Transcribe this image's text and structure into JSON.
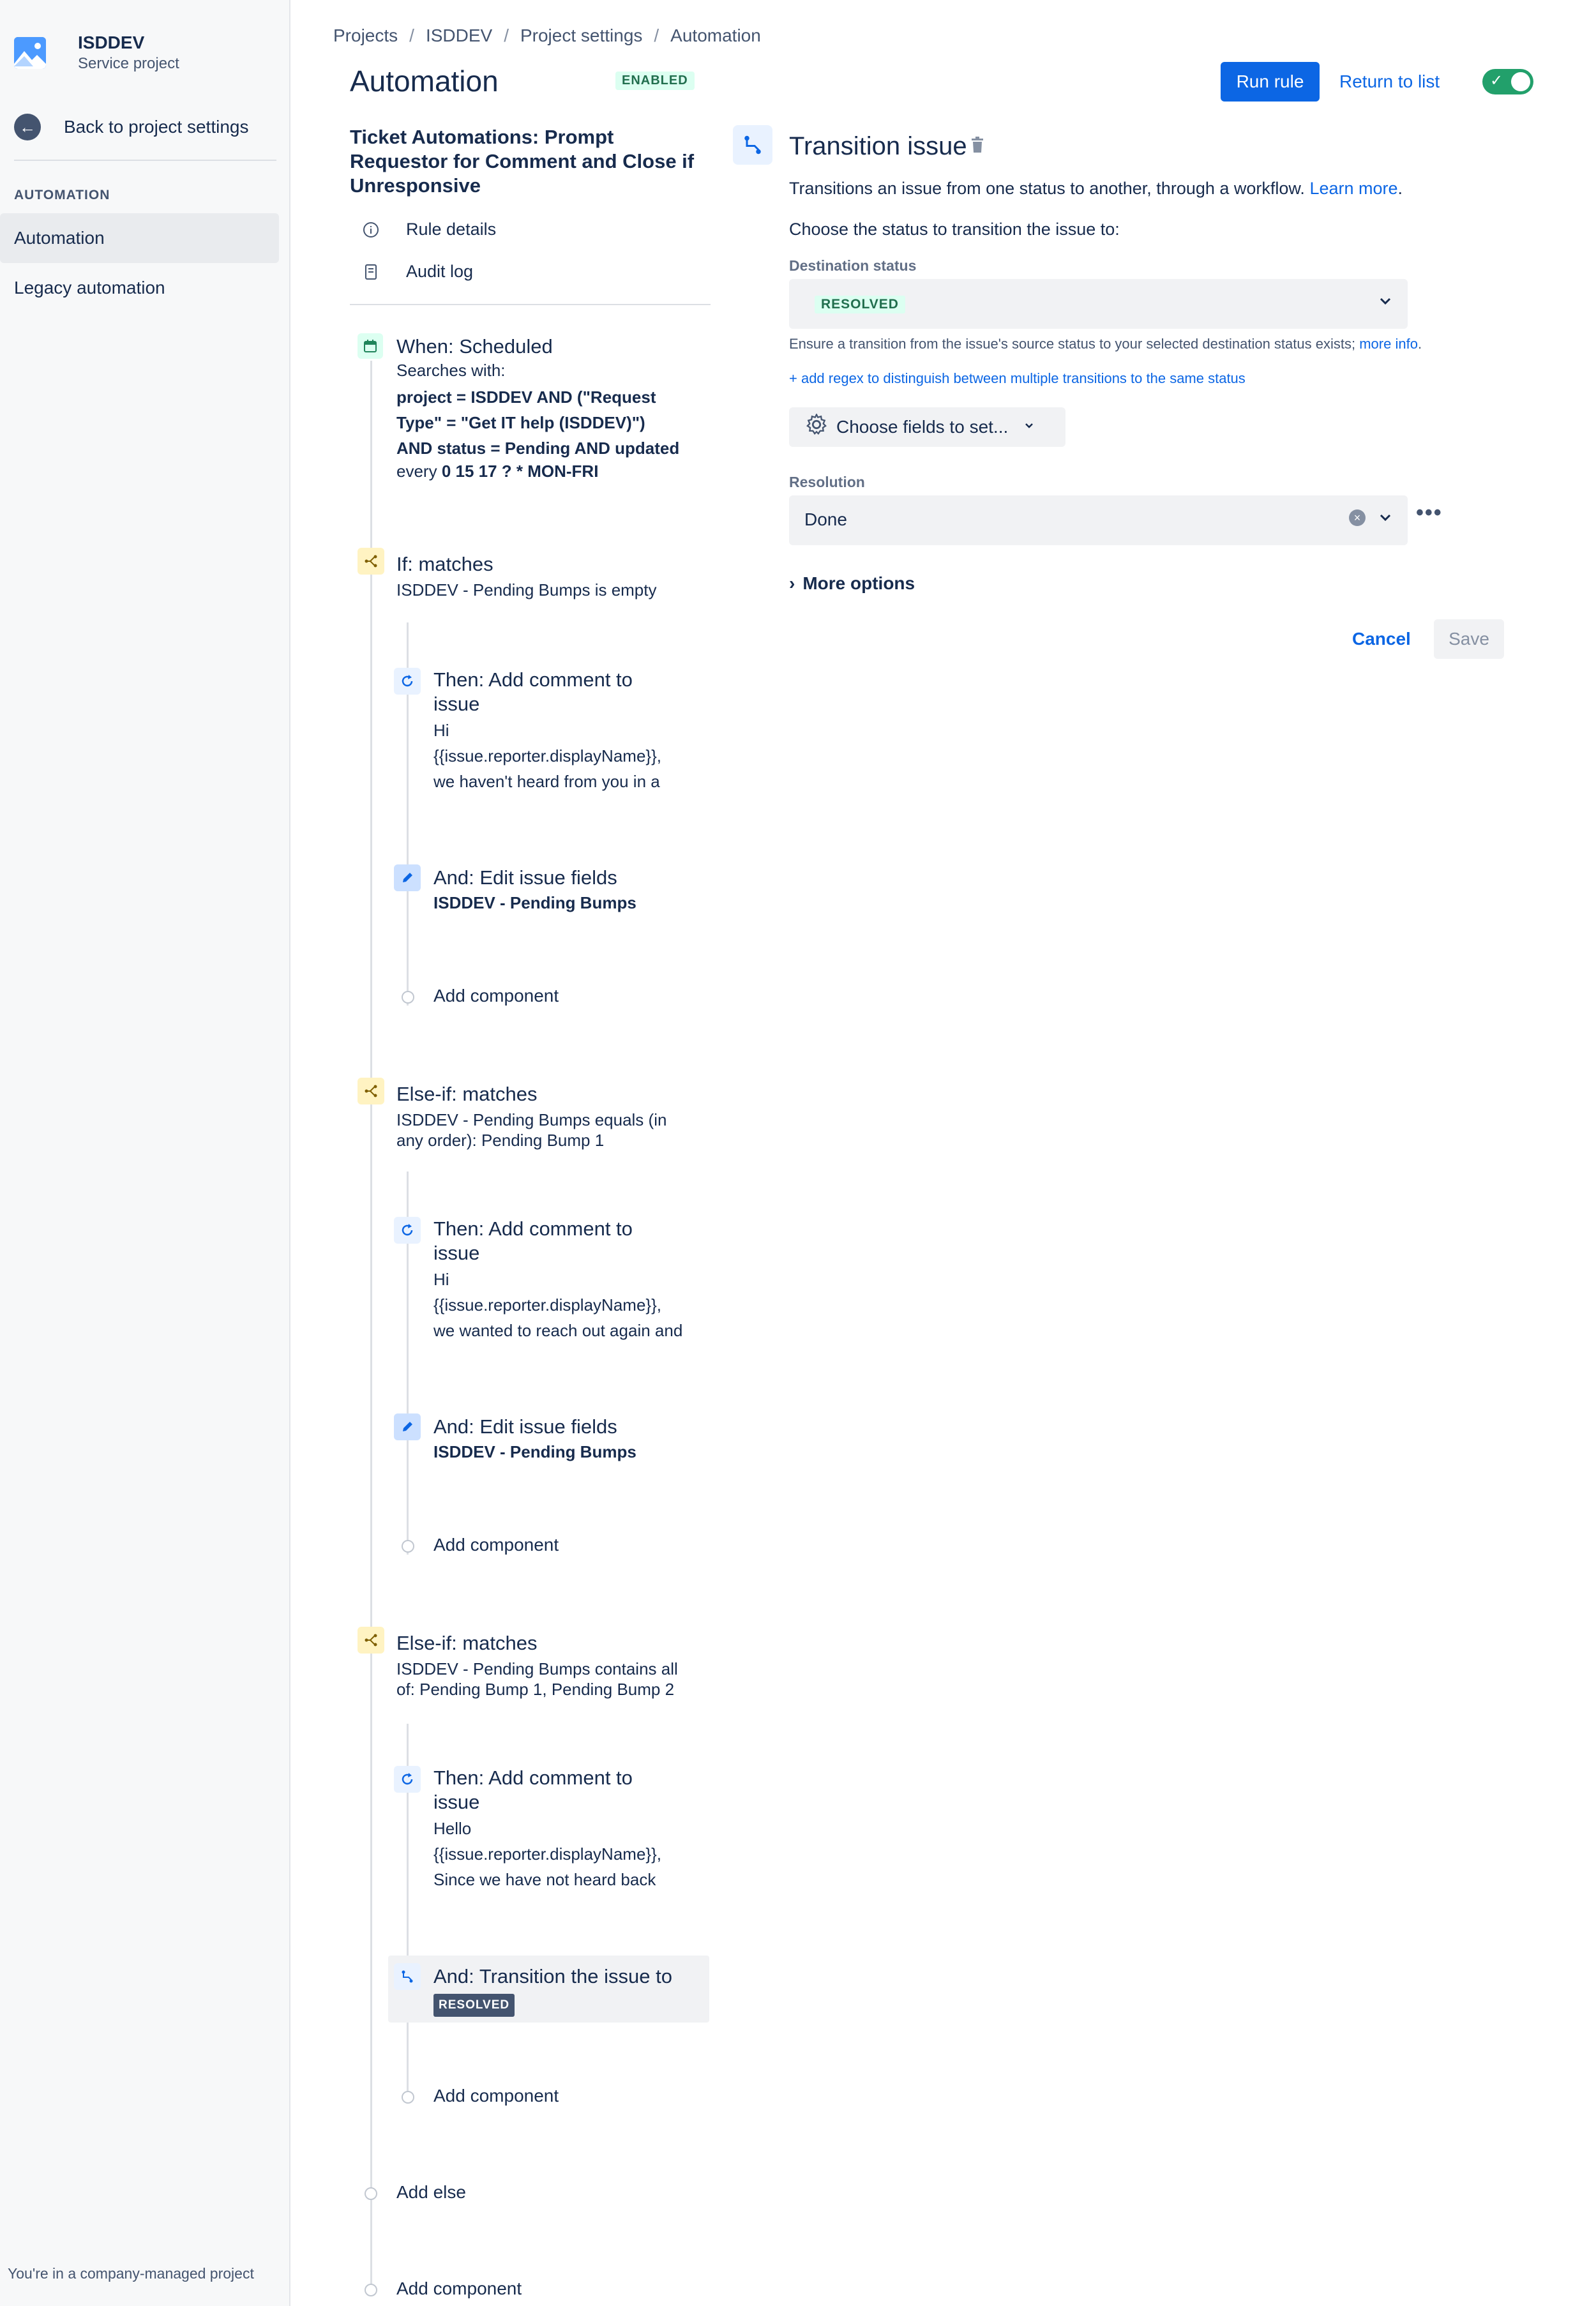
{
  "sidebar": {
    "project_name": "ISDDEV",
    "project_type": "Service project",
    "back_label": "Back to project settings",
    "section_label": "AUTOMATION",
    "items": [
      {
        "label": "Automation"
      },
      {
        "label": "Legacy automation"
      }
    ],
    "footer": "You're in a company-managed project"
  },
  "breadcrumb": [
    "Projects",
    "ISDDEV",
    "Project settings",
    "Automation"
  ],
  "header": {
    "title": "Automation",
    "status_badge": "ENABLED",
    "run_rule": "Run rule",
    "return_to_list": "Return to list"
  },
  "rule": {
    "title": "Ticket Automations: Prompt Requestor for Comment and Close if Unresponsive",
    "rule_details": "Rule details",
    "audit_log": "Audit log",
    "trigger": {
      "title": "When: Scheduled",
      "searches_with": "Searches with:",
      "jql_line1": "project = ISDDEV AND (\"Request",
      "jql_line2": "Type\" = \"Get IT help (ISDDEV)\")",
      "jql_line3": "AND status = Pending AND updated",
      "every": "every",
      "cron": "0 15 17 ? * MON-FRI"
    },
    "if1": {
      "title": "If: matches",
      "condition": "ISDDEV - Pending Bumps is empty"
    },
    "then1": {
      "title_line1": "Then: Add comment to",
      "title_line2": "issue",
      "text_line1": "Hi",
      "text_line2": "{{issue.reporter.displayName}},",
      "text_line3": "we haven't heard from you in a"
    },
    "and1": {
      "title": "And: Edit issue fields",
      "field": "ISDDEV - Pending Bumps"
    },
    "add_component": "Add component",
    "elseif1": {
      "title": "Else-if: matches",
      "cond_line1": "ISDDEV - Pending Bumps equals (in",
      "cond_line2": "any order): Pending Bump 1"
    },
    "then2": {
      "title_line1": "Then: Add comment to",
      "title_line2": "issue",
      "text_line1": "Hi",
      "text_line2": "{{issue.reporter.displayName}},",
      "text_line3": "we wanted to reach out again and"
    },
    "and2": {
      "title": "And: Edit issue fields",
      "field": "ISDDEV - Pending Bumps"
    },
    "elseif2": {
      "title": "Else-if: matches",
      "cond_line1": "ISDDEV - Pending Bumps contains all",
      "cond_line2": "of: Pending Bump 1, Pending Bump 2"
    },
    "then3": {
      "title_line1": "Then: Add comment to",
      "title_line2": "issue",
      "text_line1": "Hello",
      "text_line2": "{{issue.reporter.displayName}},",
      "text_line3": "Since we have not heard back"
    },
    "and3": {
      "title": "And: Transition the issue to",
      "status": "RESOLVED"
    },
    "add_else": "Add else"
  },
  "config": {
    "title": "Transition issue",
    "description": "Transitions an issue from one status to another, through a workflow.",
    "learn_more": "Learn more",
    "choose_prompt": "Choose the status to transition the issue to:",
    "destination_label": "Destination status",
    "destination_value": "RESOLVED",
    "ensure_text": "Ensure a transition from the issue's source status to your selected destination status exists;",
    "more_info": "more info",
    "add_regex": "+ add regex to distinguish between multiple transitions to the same status",
    "choose_fields": "Choose fields to set...",
    "resolution_label": "Resolution",
    "resolution_value": "Done",
    "more_options": "More options",
    "cancel": "Cancel",
    "save": "Save"
  },
  "colors": {
    "primary": "#0C66E4",
    "enabled_green": "#22A06B",
    "text": "#172B4D"
  }
}
